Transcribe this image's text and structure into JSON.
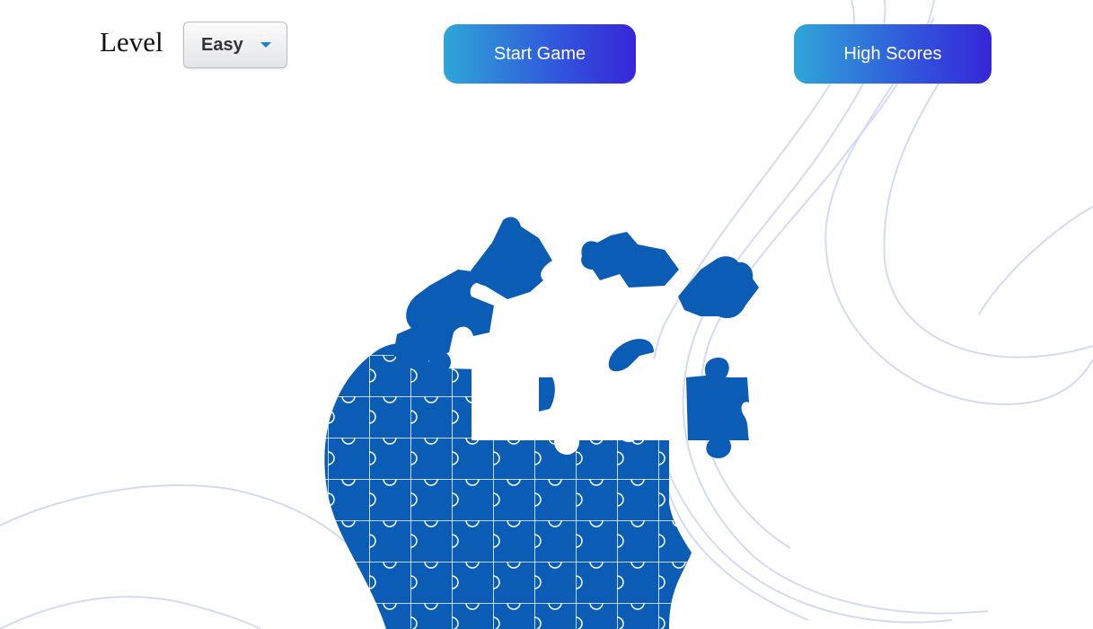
{
  "level": {
    "label": "Level",
    "selected": "Easy",
    "dropdown_icon": "caret-down-icon"
  },
  "buttons": {
    "start": "Start Game",
    "high_scores": "High Scores"
  },
  "colors": {
    "button_gradient_start": "#2fa6d8",
    "button_gradient_end": "#3626d8",
    "puzzle_blue": "#0a5cb5",
    "background_lines": "#d6d9f3",
    "caret": "#1a7fd0"
  },
  "illustration": {
    "name": "puzzle-head-illustration"
  }
}
